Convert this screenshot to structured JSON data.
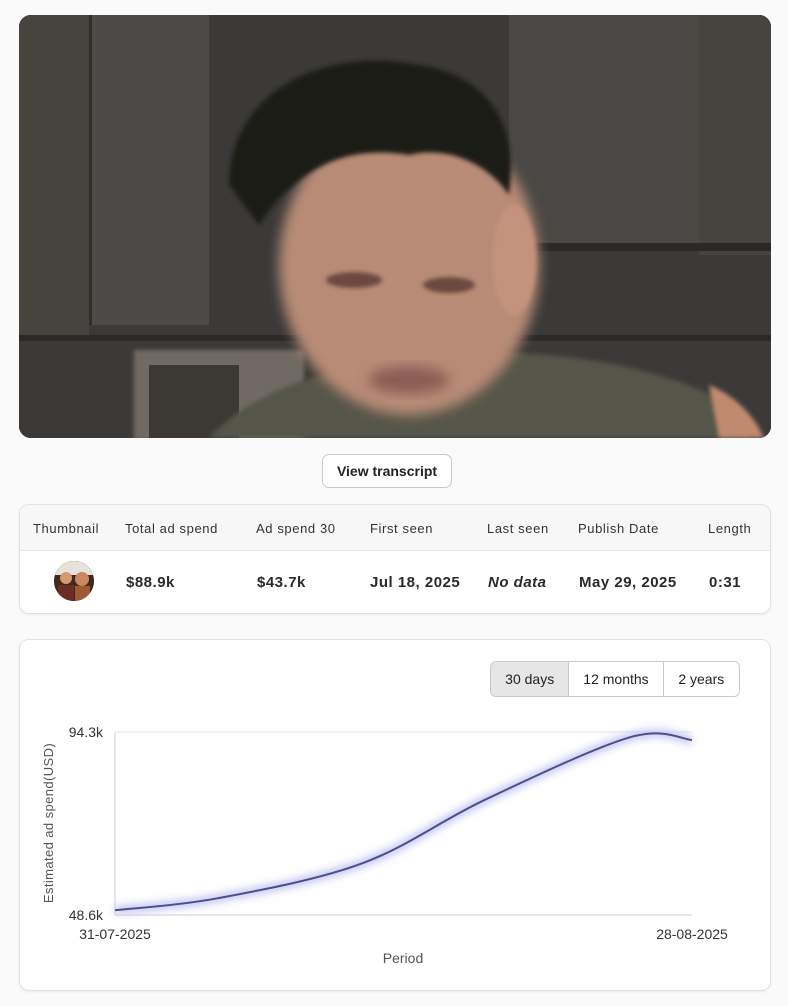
{
  "video": {
    "icon": "video-thumbnail"
  },
  "actions": {
    "view_transcript": "View transcript"
  },
  "table": {
    "headers": [
      "Thumbnail",
      "Total ad spend",
      "Ad spend 30",
      "First seen",
      "Last seen",
      "Publish Date",
      "Length"
    ],
    "row": {
      "total_ad_spend": "$88.9k",
      "ad_spend_30": "$43.7k",
      "first_seen": "Jul 18, 2025",
      "last_seen": "No data",
      "publish_date": "May 29, 2025",
      "length": "0:31"
    }
  },
  "chart_controls": {
    "ranges": [
      "30 days",
      "12 months",
      "2 years"
    ],
    "active": "30 days"
  },
  "chart_data": {
    "type": "area",
    "x": [
      "31-07-2025",
      "05-08-2025",
      "12-08-2025",
      "18-08-2025",
      "25-08-2025",
      "28-08-2025"
    ],
    "values": [
      49.8,
      52.8,
      61.5,
      77.5,
      93.0,
      92.3
    ],
    "ylim": [
      48.6,
      94.3
    ],
    "y_tick_labels": [
      "94.3k",
      "48.6k"
    ],
    "x_tick_labels": [
      "31-07-2025",
      "28-08-2025"
    ],
    "xlabel": "Period",
    "ylabel": "Estimated ad spend(USD)",
    "grid": false,
    "line_color": "#4a4f8f",
    "glow_color": "#b8b9f0"
  }
}
